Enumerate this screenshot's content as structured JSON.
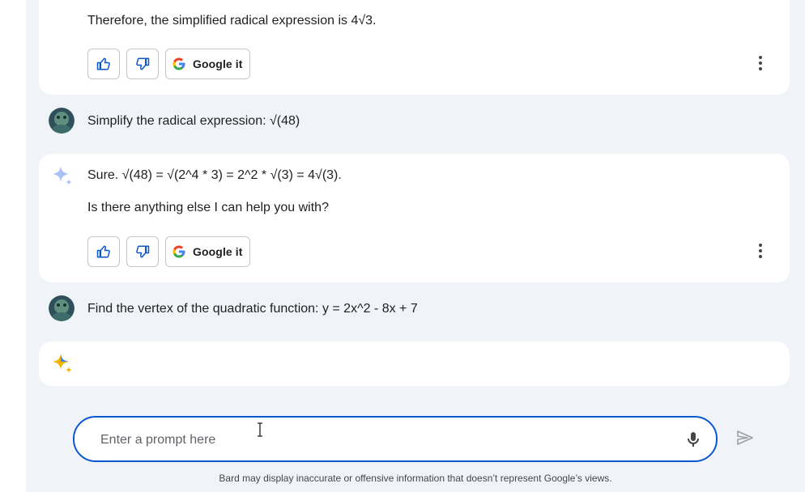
{
  "colors": {
    "chat_background": "#f0f4f9",
    "card_background": "#ffffff",
    "prompt_border": "#0b57d0",
    "google_blue": "#4285f4",
    "google_red": "#ea4335",
    "google_yellow": "#fbbc04",
    "google_green": "#34a853"
  },
  "conversation": {
    "response_1": {
      "text": "Therefore, the simplified radical expression is 4√3.",
      "actions": {
        "google_it_label": "Google it"
      }
    },
    "user_message_2": {
      "text": "Simplify the radical expression: √(48)"
    },
    "response_2": {
      "line_1": "Sure. √(48) = √(2^4 * 3) = 2^2 * √(3) = 4√(3).",
      "line_2": "Is there anything else I can help you with?",
      "actions": {
        "google_it_label": "Google it"
      }
    },
    "user_message_3": {
      "text": "Find the vertex of the quadratic function: y = 2x^2 - 8x + 7"
    },
    "response_3": {
      "text": ""
    }
  },
  "icons": {
    "thumbs_up": "thumbs-up-icon",
    "thumbs_down": "thumbs-down-icon",
    "google": "google-g-icon",
    "more": "more-vert-icon",
    "bard": "bard-sparkle-icon",
    "mic": "mic-icon",
    "send": "send-icon"
  },
  "input": {
    "placeholder": "Enter a prompt here",
    "value": ""
  },
  "footer": {
    "disclaimer": "Bard may display inaccurate or offensive information that doesn’t represent Google’s views."
  }
}
